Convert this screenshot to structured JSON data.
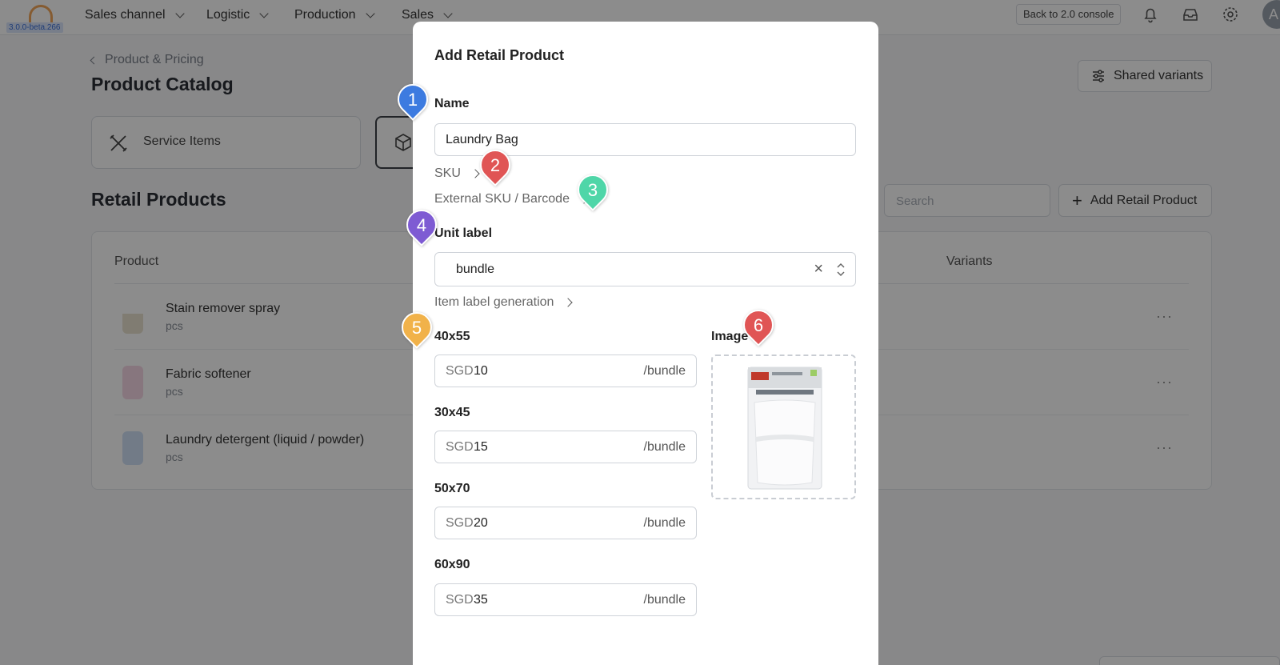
{
  "app": {
    "version": "3.0.0-beta.266",
    "nav": [
      "Sales channel",
      "Logistic",
      "Production",
      "Sales"
    ],
    "back_button": "Back to 2.0 console",
    "avatar_initial": "A"
  },
  "page": {
    "breadcrumb": "Product & Pricing",
    "title": "Product Catalog",
    "shared_variants": "Shared variants",
    "tabs": [
      "Service Items"
    ],
    "section_title": "Retail Products",
    "search_placeholder": "Search",
    "add_button": "Add Retail Product",
    "columns": {
      "product": "Product",
      "variants": "Variants"
    },
    "rows": [
      {
        "name": "Stain remover spray",
        "unit": "pcs"
      },
      {
        "name": "Fabric softener",
        "unit": "pcs"
      },
      {
        "name": "Laundry detergent (liquid / powder)",
        "unit": "pcs"
      }
    ],
    "row_menu": "···"
  },
  "modal": {
    "title": "Add Retail Product",
    "name_label": "Name",
    "name_value": "Laundry Bag",
    "sku_label": "SKU",
    "external_sku_label": "External SKU / Barcode",
    "unit_label": "Unit label",
    "unit_value": "bundle",
    "unit_clear": "×",
    "item_label_generation": "Item label generation",
    "image_label": "Image",
    "variants": [
      {
        "label": "40x55",
        "currency": "SGD",
        "price": "10",
        "per_unit": "/bundle"
      },
      {
        "label": "30x45",
        "currency": "SGD",
        "price": "15",
        "per_unit": "/bundle"
      },
      {
        "label": "50x70",
        "currency": "SGD",
        "price": "20",
        "per_unit": "/bundle"
      },
      {
        "label": "60x90",
        "currency": "SGD",
        "price": "35",
        "per_unit": "/bundle"
      }
    ]
  },
  "markers": [
    {
      "num": "1",
      "color": "#3d7be0"
    },
    {
      "num": "2",
      "color": "#e05555"
    },
    {
      "num": "3",
      "color": "#4fd6a8"
    },
    {
      "num": "4",
      "color": "#7e5bd3"
    },
    {
      "num": "5",
      "color": "#f1b24a"
    },
    {
      "num": "6",
      "color": "#e05555"
    }
  ]
}
